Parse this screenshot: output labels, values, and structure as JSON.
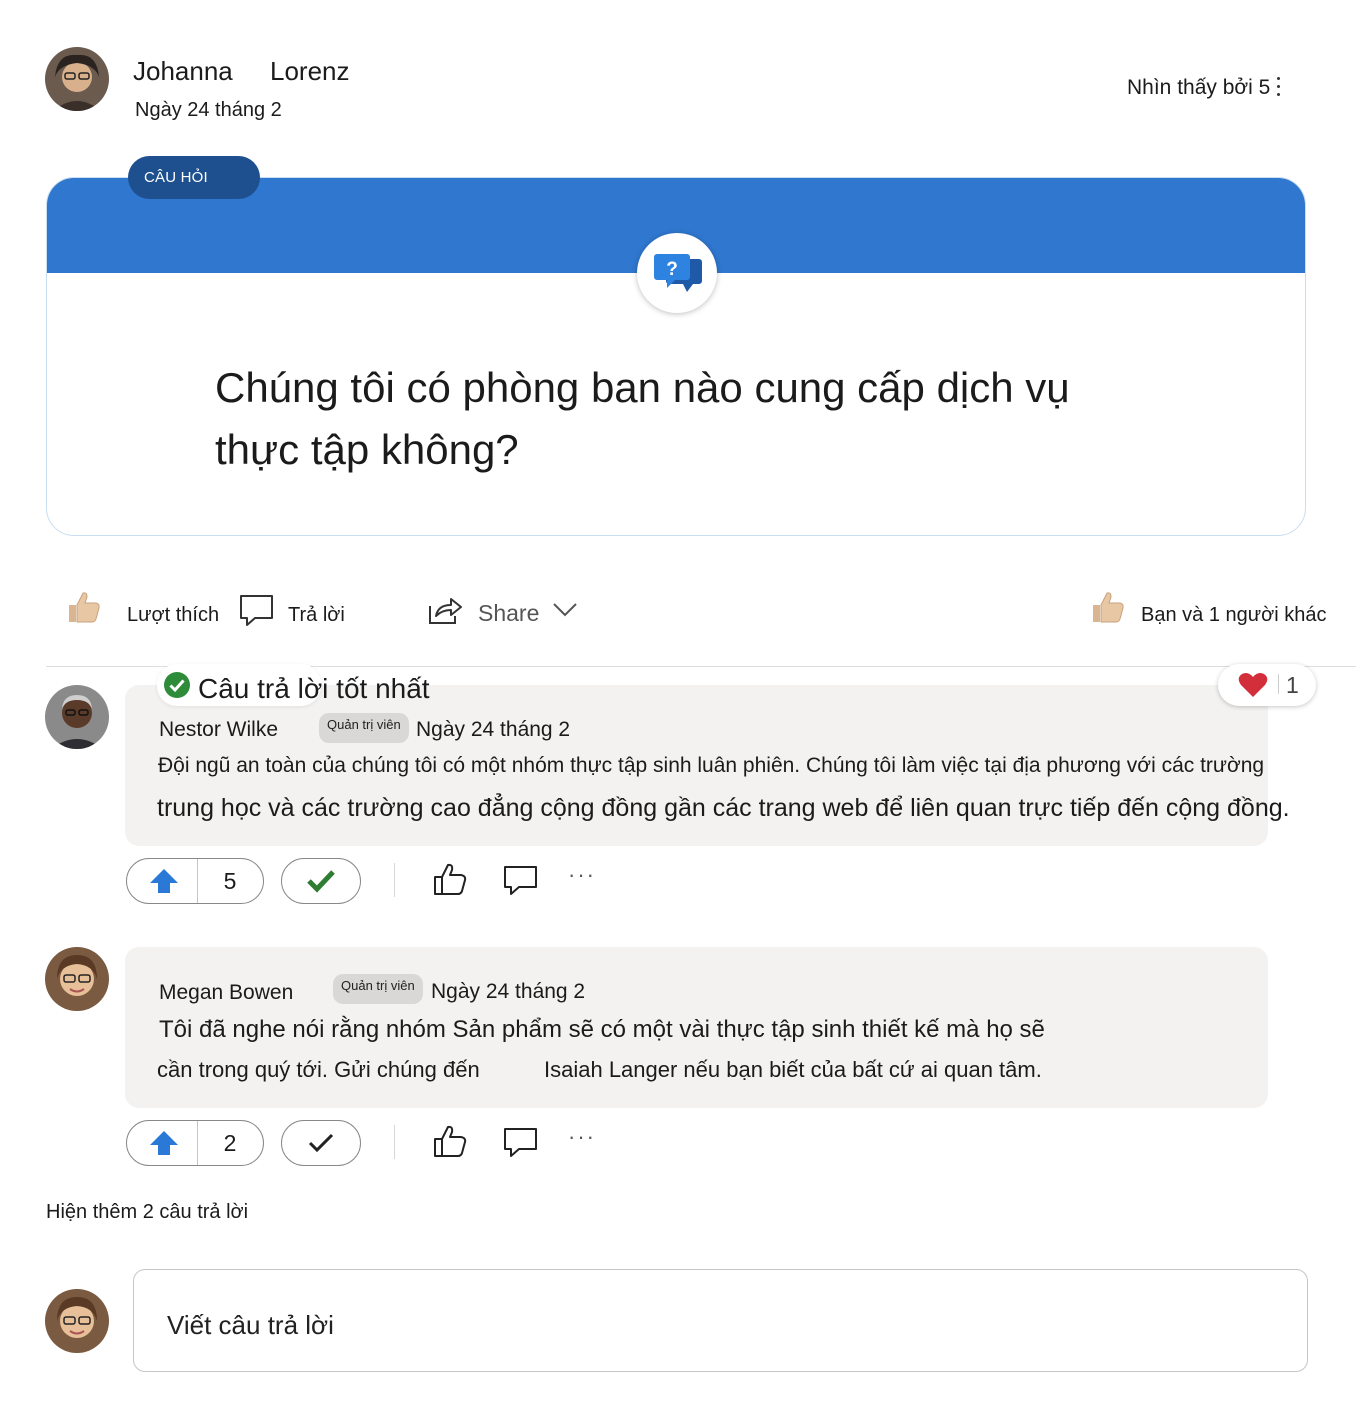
{
  "post": {
    "author_first": "Johanna",
    "author_last": "Lorenz",
    "date": "Ngày 24 tháng 2",
    "seen_by": "Nhìn thấy bởi 5"
  },
  "question_card": {
    "tag": "CÂU HỎI",
    "text": "Chúng tôi có phòng ban nào cung cấp dịch vụ thực tập không?",
    "banner_color": "#2f77cf"
  },
  "actions": {
    "like": "Lượt thích",
    "reply": "Trả lời",
    "share": "Share",
    "reactions_summary": "Bạn và 1 người khác"
  },
  "best_answer": {
    "badge": "Câu trả lời tốt nhất",
    "heart_count": "1",
    "author": "Nestor Wilke",
    "role": "Quản trị viên",
    "date": "Ngày 24 tháng 2",
    "text_line1": "Đội ngũ an toàn của chúng tôi có một nhóm thực tập sinh luân phiên. Chúng tôi làm việc tại địa phương với các trường",
    "text_line2": "trung học và các trường cao đẳng cộng đồng gần các trang web để liên quan trực tiếp đến cộng đồng.",
    "upvotes": "5",
    "more": "···"
  },
  "reply2": {
    "author": "Megan Bowen",
    "role": "Quản trị viên",
    "date": "Ngày 24 tháng 2",
    "text_line1": "Tôi đã nghe nói rằng nhóm Sản phẩm sẽ có một vài thực tập sinh thiết kế mà họ sẽ",
    "text_line2a": "cần trong quý tới. Gửi chúng đến",
    "text_line2b": "Isaiah Langer nếu bạn biết của bất cứ ai quan tâm.",
    "upvotes": "2",
    "more": "···"
  },
  "show_more": "Hiện thêm 2 câu trả lời",
  "composer": {
    "placeholder": "Viết câu trả lời"
  },
  "colors": {
    "accent_blue": "#2f77cf",
    "tag_blue": "#1e4f8e",
    "upvote_blue": "#2b79d6",
    "check_green": "#2e7d32",
    "heart_red": "#d32f3a"
  }
}
